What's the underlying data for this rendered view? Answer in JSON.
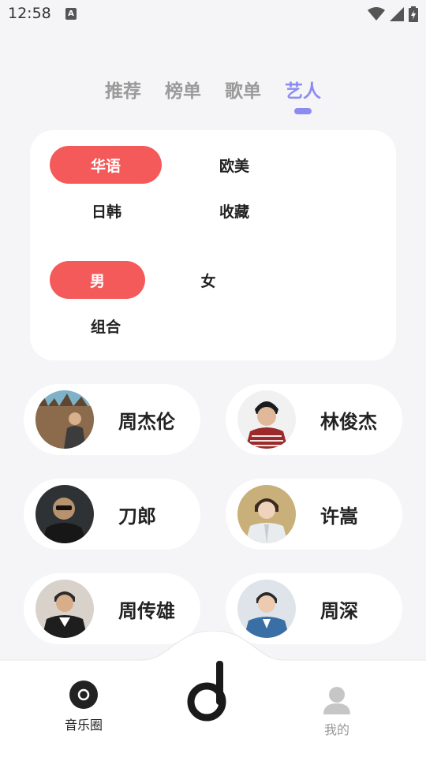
{
  "status_bar": {
    "time": "12:58",
    "left_icon": "A"
  },
  "tabs": [
    {
      "label": "推荐",
      "active": false
    },
    {
      "label": "榜单",
      "active": false
    },
    {
      "label": "歌单",
      "active": false
    },
    {
      "label": "艺人",
      "active": true
    }
  ],
  "filters": {
    "region": [
      {
        "label": "华语",
        "selected": true
      },
      {
        "label": "欧美",
        "selected": false
      },
      {
        "label": "日韩",
        "selected": false
      },
      {
        "label": "收藏",
        "selected": false
      }
    ],
    "gender": [
      {
        "label": "男",
        "selected": true
      },
      {
        "label": "女",
        "selected": false
      },
      {
        "label": "组合",
        "selected": false
      }
    ]
  },
  "artists": [
    {
      "name": "周杰伦"
    },
    {
      "name": "林俊杰"
    },
    {
      "name": "刀郎"
    },
    {
      "name": "许嵩"
    },
    {
      "name": "周传雄"
    },
    {
      "name": "周深"
    }
  ],
  "bottom_nav": {
    "left": {
      "label": "音乐圈",
      "icon": "record-icon"
    },
    "center": {
      "icon": "music-note-d-icon"
    },
    "right": {
      "label": "我的",
      "icon": "person-icon"
    }
  },
  "colors": {
    "accent": "#8c8cf0",
    "chip_selected": "#f45a5a",
    "background": "#f5f5f7"
  }
}
